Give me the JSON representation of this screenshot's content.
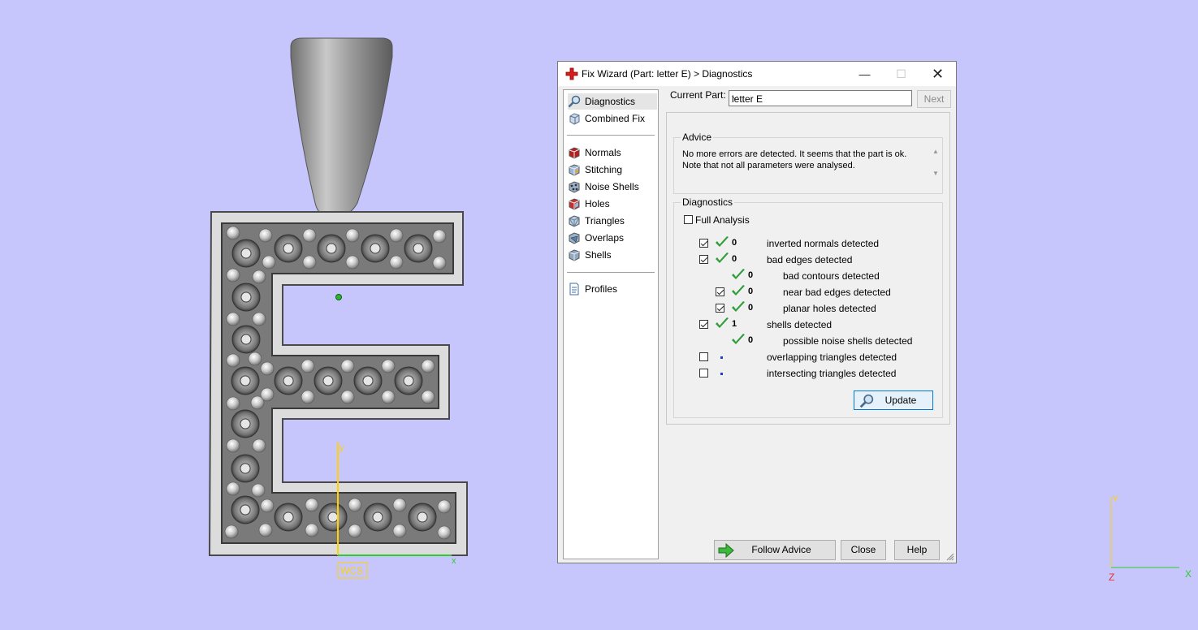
{
  "viewport": {
    "wcs_label": "WCS",
    "axis_x": "x",
    "axis_y": "y",
    "corner_axis_x": "X",
    "corner_axis_y": "Y",
    "corner_axis_z": "Z"
  },
  "dialog": {
    "title": "Fix Wizard (Part: letter E) > Diagnostics",
    "nav": {
      "top": [
        "Diagnostics",
        "Combined Fix"
      ],
      "middle": [
        "Normals",
        "Stitching",
        "Noise Shells",
        "Holes",
        "Triangles",
        "Overlaps",
        "Shells"
      ],
      "bottom": [
        "Profiles"
      ],
      "selected": "Diagnostics"
    },
    "current_part_label": "Current Part:",
    "current_part_value": "letter E",
    "next_label": "Next",
    "advice": {
      "title": "Advice",
      "line1": "No more errors are detected. It seems that the part is ok.",
      "line2": "Note that not all parameters were analysed."
    },
    "diagnostics": {
      "title": "Diagnostics",
      "full_analysis_label": "Full Analysis",
      "full_analysis_checked": false,
      "rows": [
        {
          "checked": true,
          "status": "ok",
          "count": "0",
          "text": "inverted normals detected"
        },
        {
          "checked": true,
          "status": "ok",
          "count": "0",
          "text": "bad edges detected"
        },
        {
          "checked": null,
          "status": "ok",
          "count": "0",
          "text": "bad contours detected"
        },
        {
          "checked": true,
          "status": "ok",
          "count": "0",
          "text": "near bad edges detected"
        },
        {
          "checked": true,
          "status": "ok",
          "count": "0",
          "text": "planar holes detected"
        },
        {
          "checked": true,
          "status": "ok",
          "count": "1",
          "text": "shells detected"
        },
        {
          "checked": null,
          "status": "ok",
          "count": "0",
          "text": "possible noise shells detected"
        },
        {
          "checked": false,
          "status": "dot",
          "count": "",
          "text": "overlapping triangles detected"
        },
        {
          "checked": false,
          "status": "dot",
          "count": "",
          "text": "intersecting triangles detected"
        }
      ],
      "update_label": "Update"
    },
    "follow_advice_label": "Follow Advice",
    "close_label": "Close",
    "help_label": "Help"
  }
}
